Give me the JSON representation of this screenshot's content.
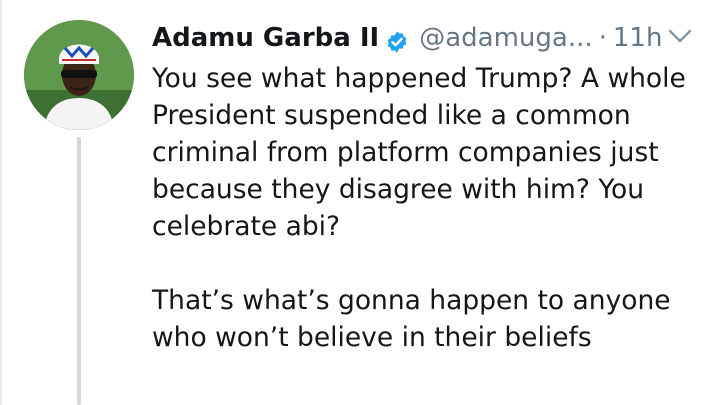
{
  "author": {
    "name": "Adamu Garba II",
    "handle": "@adamuga...",
    "verified": true,
    "avatar_icon": "profile-photo"
  },
  "tweet": {
    "separator": "·",
    "time": "11h",
    "paragraphs": [
      "You see what happened Trump? A whole President suspended like a common criminal from platform companies just because they disagree with him? You celebrate abi?",
      "That’s what’s gonna happen to anyone who won’t believe in their beliefs"
    ]
  },
  "colors": {
    "name": "#14171a",
    "secondary": "#657786",
    "verified": "#1da1f2",
    "thread_line": "#cfd9de"
  },
  "icons": {
    "verified": "verified-badge-icon",
    "menu": "chevron-down-icon"
  }
}
